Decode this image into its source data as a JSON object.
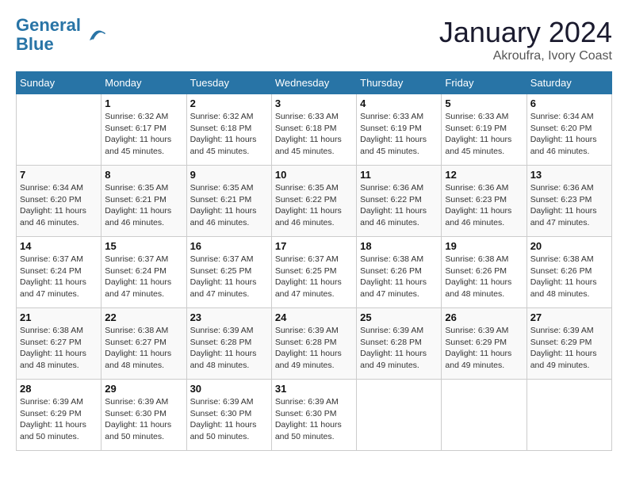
{
  "header": {
    "logo_line1": "General",
    "logo_line2": "Blue",
    "month": "January 2024",
    "location": "Akroufra, Ivory Coast"
  },
  "weekdays": [
    "Sunday",
    "Monday",
    "Tuesday",
    "Wednesday",
    "Thursday",
    "Friday",
    "Saturday"
  ],
  "weeks": [
    [
      {
        "day": "",
        "info": ""
      },
      {
        "day": "1",
        "info": "Sunrise: 6:32 AM\nSunset: 6:17 PM\nDaylight: 11 hours and 45 minutes."
      },
      {
        "day": "2",
        "info": "Sunrise: 6:32 AM\nSunset: 6:18 PM\nDaylight: 11 hours and 45 minutes."
      },
      {
        "day": "3",
        "info": "Sunrise: 6:33 AM\nSunset: 6:18 PM\nDaylight: 11 hours and 45 minutes."
      },
      {
        "day": "4",
        "info": "Sunrise: 6:33 AM\nSunset: 6:19 PM\nDaylight: 11 hours and 45 minutes."
      },
      {
        "day": "5",
        "info": "Sunrise: 6:33 AM\nSunset: 6:19 PM\nDaylight: 11 hours and 45 minutes."
      },
      {
        "day": "6",
        "info": "Sunrise: 6:34 AM\nSunset: 6:20 PM\nDaylight: 11 hours and 46 minutes."
      }
    ],
    [
      {
        "day": "7",
        "info": "Sunrise: 6:34 AM\nSunset: 6:20 PM\nDaylight: 11 hours and 46 minutes."
      },
      {
        "day": "8",
        "info": "Sunrise: 6:35 AM\nSunset: 6:21 PM\nDaylight: 11 hours and 46 minutes."
      },
      {
        "day": "9",
        "info": "Sunrise: 6:35 AM\nSunset: 6:21 PM\nDaylight: 11 hours and 46 minutes."
      },
      {
        "day": "10",
        "info": "Sunrise: 6:35 AM\nSunset: 6:22 PM\nDaylight: 11 hours and 46 minutes."
      },
      {
        "day": "11",
        "info": "Sunrise: 6:36 AM\nSunset: 6:22 PM\nDaylight: 11 hours and 46 minutes."
      },
      {
        "day": "12",
        "info": "Sunrise: 6:36 AM\nSunset: 6:23 PM\nDaylight: 11 hours and 46 minutes."
      },
      {
        "day": "13",
        "info": "Sunrise: 6:36 AM\nSunset: 6:23 PM\nDaylight: 11 hours and 47 minutes."
      }
    ],
    [
      {
        "day": "14",
        "info": "Sunrise: 6:37 AM\nSunset: 6:24 PM\nDaylight: 11 hours and 47 minutes."
      },
      {
        "day": "15",
        "info": "Sunrise: 6:37 AM\nSunset: 6:24 PM\nDaylight: 11 hours and 47 minutes."
      },
      {
        "day": "16",
        "info": "Sunrise: 6:37 AM\nSunset: 6:25 PM\nDaylight: 11 hours and 47 minutes."
      },
      {
        "day": "17",
        "info": "Sunrise: 6:37 AM\nSunset: 6:25 PM\nDaylight: 11 hours and 47 minutes."
      },
      {
        "day": "18",
        "info": "Sunrise: 6:38 AM\nSunset: 6:26 PM\nDaylight: 11 hours and 47 minutes."
      },
      {
        "day": "19",
        "info": "Sunrise: 6:38 AM\nSunset: 6:26 PM\nDaylight: 11 hours and 48 minutes."
      },
      {
        "day": "20",
        "info": "Sunrise: 6:38 AM\nSunset: 6:26 PM\nDaylight: 11 hours and 48 minutes."
      }
    ],
    [
      {
        "day": "21",
        "info": "Sunrise: 6:38 AM\nSunset: 6:27 PM\nDaylight: 11 hours and 48 minutes."
      },
      {
        "day": "22",
        "info": "Sunrise: 6:38 AM\nSunset: 6:27 PM\nDaylight: 11 hours and 48 minutes."
      },
      {
        "day": "23",
        "info": "Sunrise: 6:39 AM\nSunset: 6:28 PM\nDaylight: 11 hours and 48 minutes."
      },
      {
        "day": "24",
        "info": "Sunrise: 6:39 AM\nSunset: 6:28 PM\nDaylight: 11 hours and 49 minutes."
      },
      {
        "day": "25",
        "info": "Sunrise: 6:39 AM\nSunset: 6:28 PM\nDaylight: 11 hours and 49 minutes."
      },
      {
        "day": "26",
        "info": "Sunrise: 6:39 AM\nSunset: 6:29 PM\nDaylight: 11 hours and 49 minutes."
      },
      {
        "day": "27",
        "info": "Sunrise: 6:39 AM\nSunset: 6:29 PM\nDaylight: 11 hours and 49 minutes."
      }
    ],
    [
      {
        "day": "28",
        "info": "Sunrise: 6:39 AM\nSunset: 6:29 PM\nDaylight: 11 hours and 50 minutes."
      },
      {
        "day": "29",
        "info": "Sunrise: 6:39 AM\nSunset: 6:30 PM\nDaylight: 11 hours and 50 minutes."
      },
      {
        "day": "30",
        "info": "Sunrise: 6:39 AM\nSunset: 6:30 PM\nDaylight: 11 hours and 50 minutes."
      },
      {
        "day": "31",
        "info": "Sunrise: 6:39 AM\nSunset: 6:30 PM\nDaylight: 11 hours and 50 minutes."
      },
      {
        "day": "",
        "info": ""
      },
      {
        "day": "",
        "info": ""
      },
      {
        "day": "",
        "info": ""
      }
    ]
  ]
}
